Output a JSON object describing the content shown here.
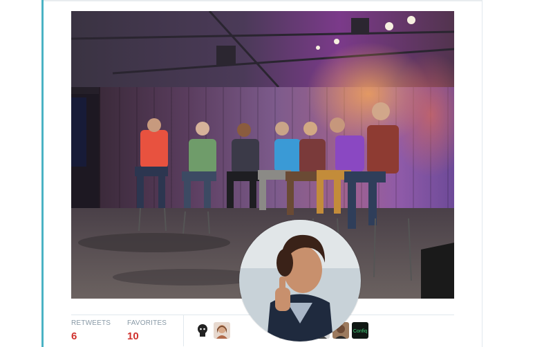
{
  "tweet": {
    "photo_alt": "",
    "stats": {
      "retweets_label": "RETWEETS",
      "retweets_value": "6",
      "favorites_label": "FAVORITES",
      "favorites_value": "10"
    },
    "favoriters": [
      {
        "icon": "octocat-icon"
      },
      {
        "icon": "avatar-woman"
      },
      {
        "icon": "avatar-placeholder"
      },
      {
        "icon": "avatar-placeholder"
      },
      {
        "icon": "avatar-orange-logo"
      },
      {
        "icon": "avatar-man-glasses"
      },
      {
        "icon": "avatar-man-dark"
      },
      {
        "icon": "confiq-logo",
        "text": "Confiq"
      }
    ]
  },
  "colors": {
    "accent": "#4ab3c4",
    "stat_value": "#d0312d",
    "stat_label": "#8899a6",
    "divider": "#e1e8ed"
  }
}
